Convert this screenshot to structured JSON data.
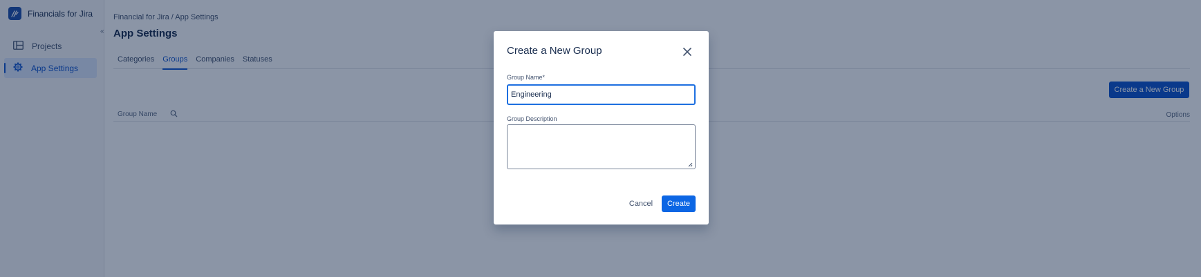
{
  "app": {
    "name": "Financials for Jira",
    "collapse_label": "«"
  },
  "sidebar": {
    "items": [
      {
        "label": "Projects",
        "icon": "projects-icon"
      },
      {
        "label": "App Settings",
        "icon": "gear-icon",
        "active": true
      }
    ]
  },
  "breadcrumb": "Financial for Jira  / App Settings",
  "page_title": "App Settings",
  "tabs": [
    {
      "label": "Categories"
    },
    {
      "label": "Groups",
      "active": true
    },
    {
      "label": "Companies"
    },
    {
      "label": "Statuses"
    }
  ],
  "toolbar": {
    "create_label": "Create a New Group"
  },
  "table": {
    "columns": {
      "name": "Group Name",
      "search_icon": "search-icon",
      "options": "Options"
    }
  },
  "modal": {
    "title": "Create a New Group",
    "close_icon": "close-icon",
    "name_label": "Group Name*",
    "name_value": "Engineering",
    "description_label": "Group Description",
    "description_value": "",
    "cancel_label": "Cancel",
    "create_label": "Create"
  },
  "colors": {
    "primary": "#0c52cc",
    "overlay": "#091e42",
    "focus": "#1d6fe0"
  }
}
